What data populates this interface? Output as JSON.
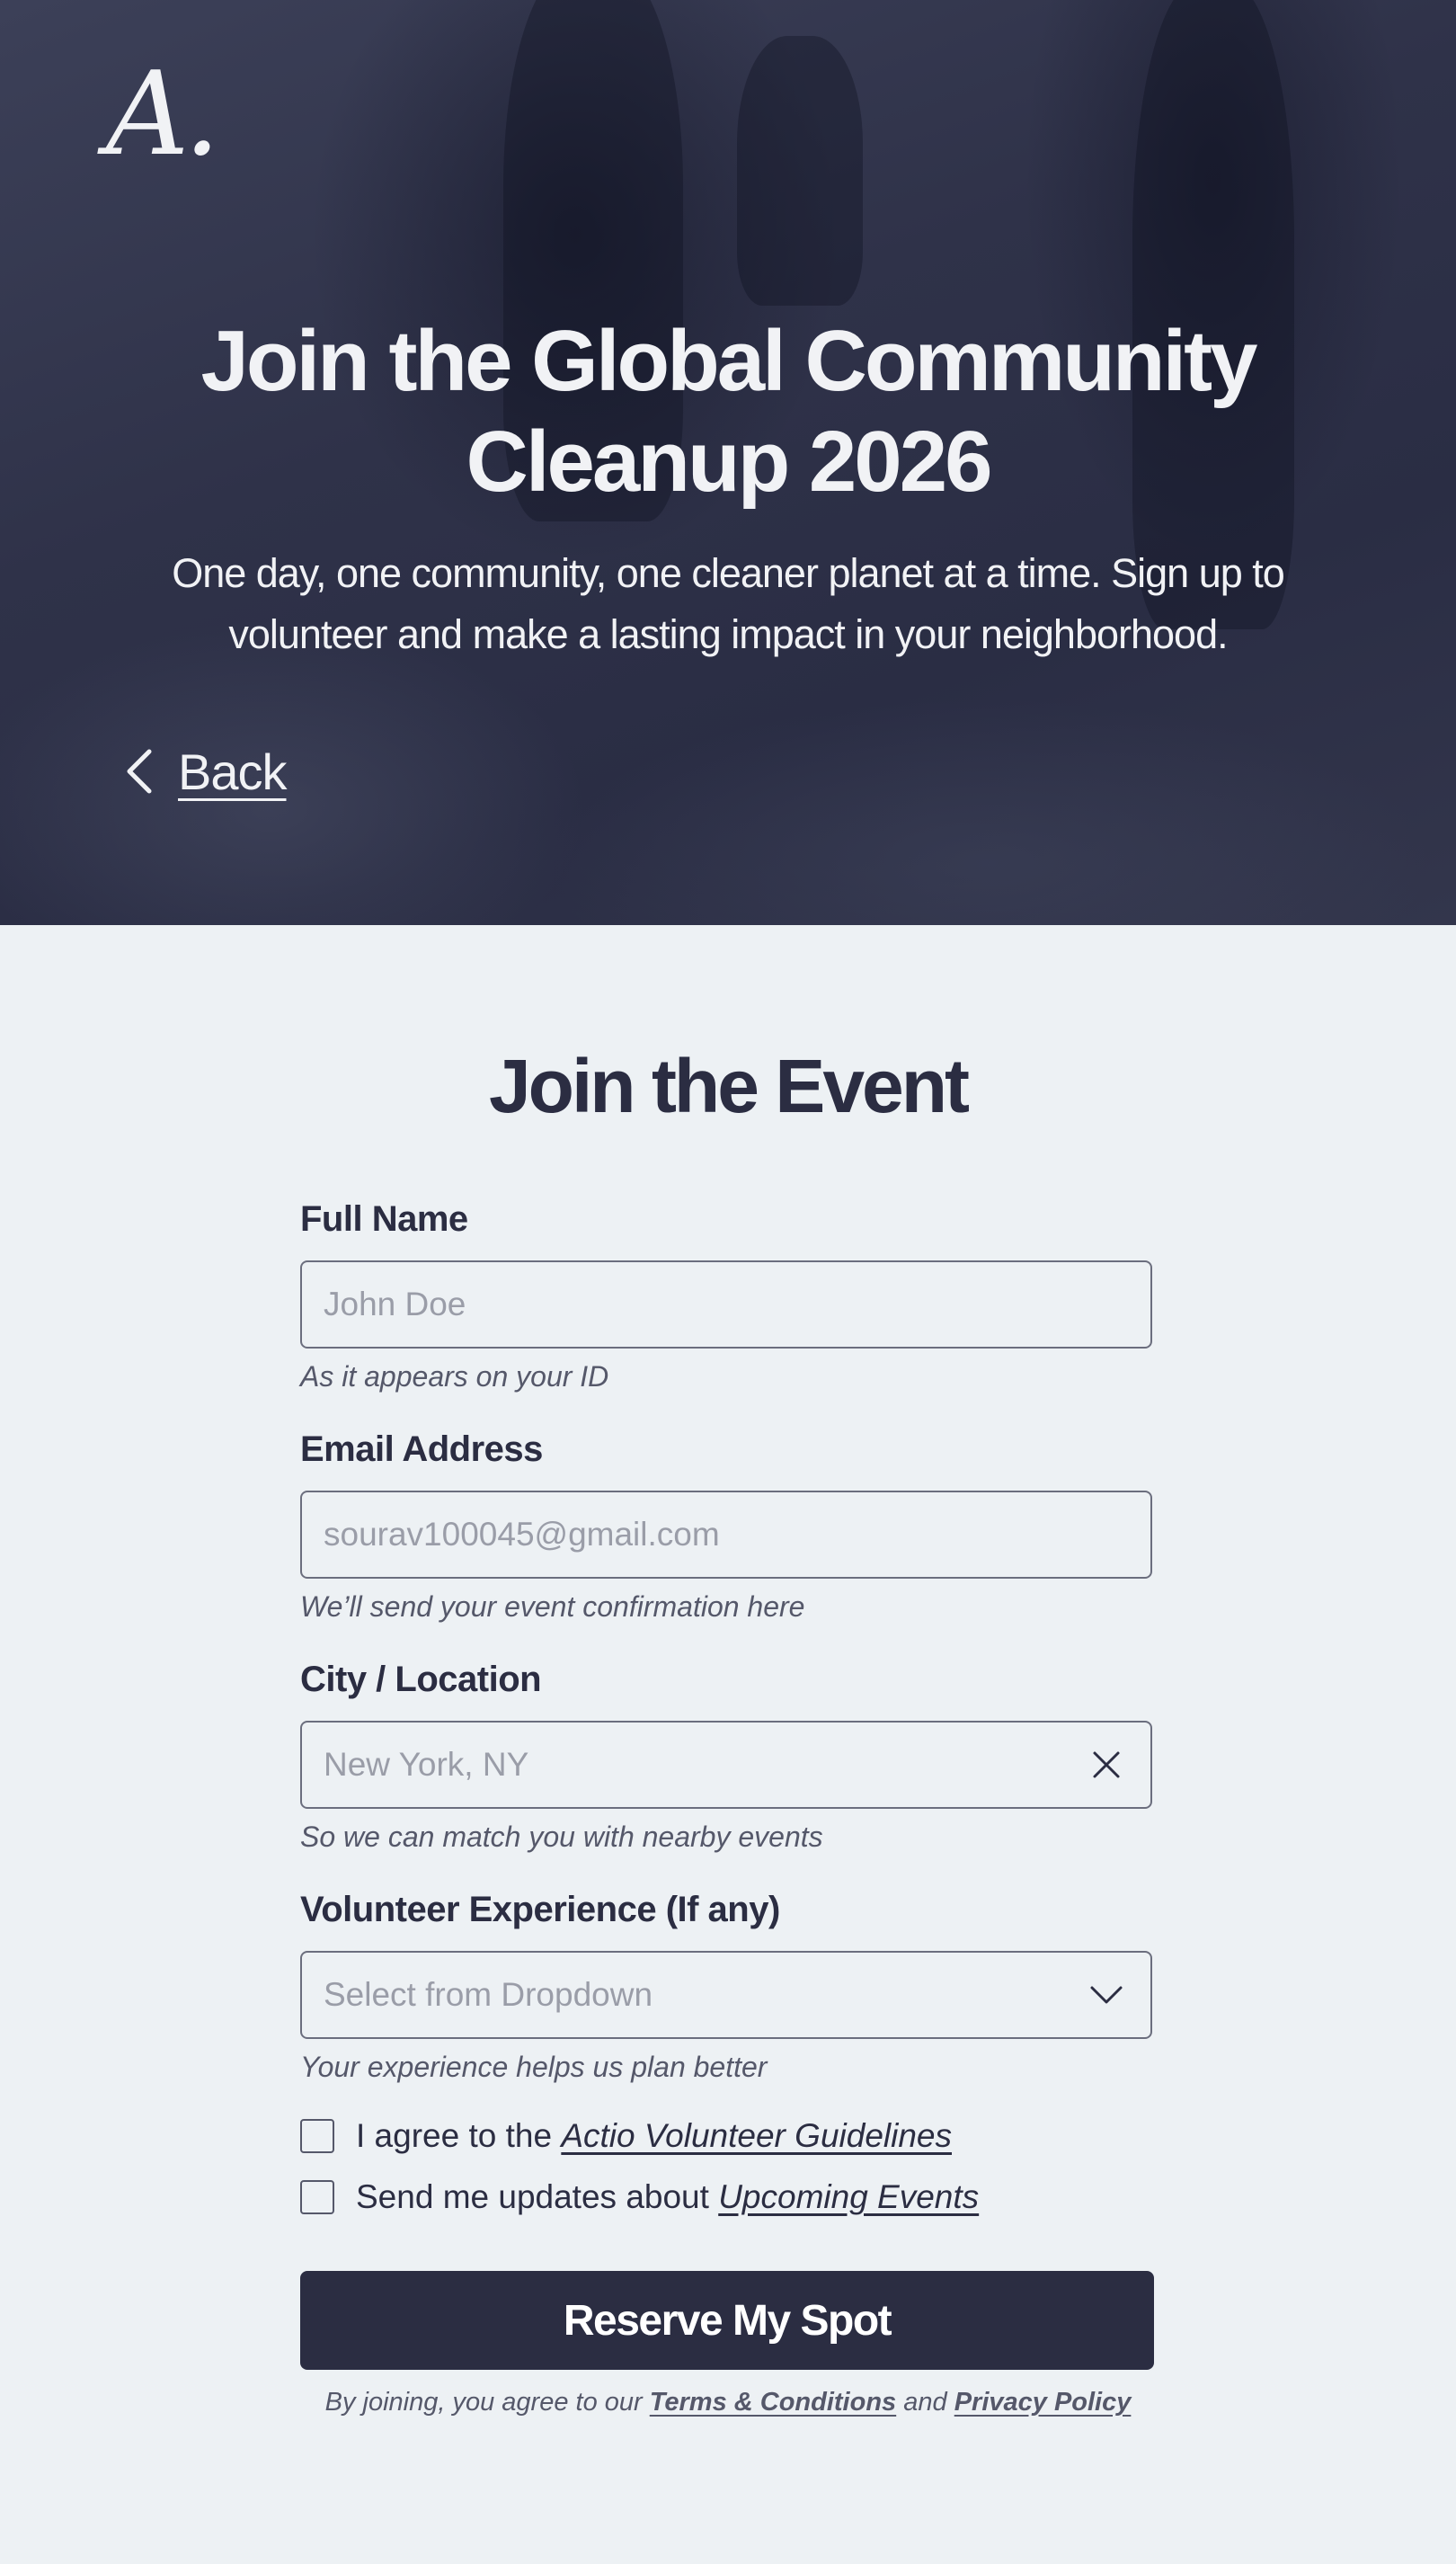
{
  "hero": {
    "logo_text": "A.",
    "title": "Join the Global Community Cleanup 2026",
    "subtitle": "One day, one community, one cleaner planet at a time. Sign up to volunteer and make a lasting impact in your neighborhood.",
    "back_label": "Back"
  },
  "form": {
    "title": "Join the Event",
    "full_name": {
      "label": "Full Name",
      "placeholder": "John Doe",
      "hint": "As it appears on your ID"
    },
    "email": {
      "label": "Email Address",
      "placeholder": "sourav100045@gmail.com",
      "hint": "We’ll send your event confirmation here"
    },
    "city": {
      "label": "City / Location",
      "placeholder": "New York, NY",
      "hint": "So we can match you with nearby events"
    },
    "experience": {
      "label": "Volunteer Experience (If any)",
      "selected": "Select from Dropdown",
      "hint": "Your experience helps us plan better"
    },
    "agree": {
      "prefix": "I agree to the ",
      "link": "Actio Volunteer Guidelines"
    },
    "updates": {
      "prefix": "Send me updates about ",
      "link": "Upcoming Events"
    },
    "submit_label": "Reserve My Spot",
    "legal": {
      "prefix": "By joining, you agree to our ",
      "terms": "Terms & Conditions",
      "middle": " and ",
      "privacy": "Privacy Policy"
    }
  },
  "colors": {
    "primary": "#2b2d42",
    "background": "#edf1f4",
    "hero_overlay": "#2f3249"
  }
}
